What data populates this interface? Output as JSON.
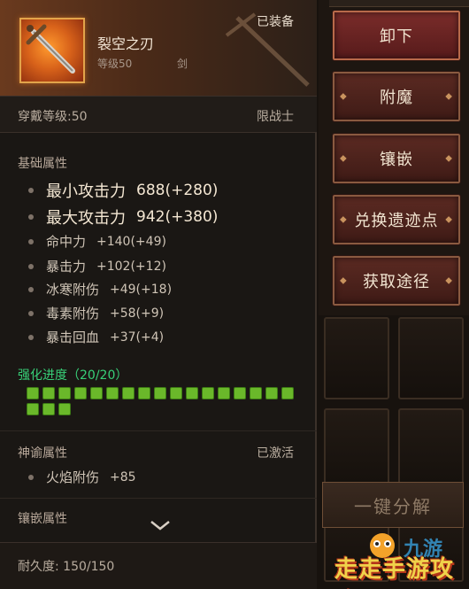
{
  "item": {
    "name": "裂空之刃",
    "level": "等级50",
    "type": "剑",
    "status": "已装备"
  },
  "requirement": {
    "label": "穿戴等级:50",
    "class": "限战士"
  },
  "base_attributes": {
    "title": "基础属性",
    "items": [
      {
        "name": "最小攻击力",
        "value": "688(+280)"
      },
      {
        "name": "最大攻击力",
        "value": "942(+380)"
      },
      {
        "name": "命中力",
        "value": "+140(+49)"
      },
      {
        "name": "暴击力",
        "value": "+102(+12)"
      },
      {
        "name": "冰寒附伤",
        "value": "+49(+18)"
      },
      {
        "name": "毒素附伤",
        "value": "+58(+9)"
      },
      {
        "name": "暴击回血",
        "value": "+37(+4)"
      }
    ]
  },
  "enhancement": {
    "title": "强化进度（20/20）",
    "current": 20,
    "max": 20
  },
  "oracle": {
    "title": "神谕属性",
    "status": "已激活",
    "items": [
      {
        "name": "火焰附伤",
        "value": "+85"
      }
    ]
  },
  "socket": {
    "title": "镶嵌属性"
  },
  "durability": {
    "label": "耐久度:  150/150"
  },
  "actions": {
    "unequip": "卸下",
    "enchant": "附魔",
    "inlay": "镶嵌",
    "exchange": "兑换遗迹点",
    "source": "获取途径",
    "decompose": "一键分解"
  },
  "watermark": {
    "text": "走走手游攻略",
    "brand": "九游"
  },
  "colors": {
    "enhance_green": "#6ab82a",
    "enhance_title": "#38d078",
    "button_red": "#5b2a22",
    "icon_orange": "#d8621a"
  },
  "icons": {
    "item": "sword-icon",
    "expand": "chevron-down-icon"
  }
}
